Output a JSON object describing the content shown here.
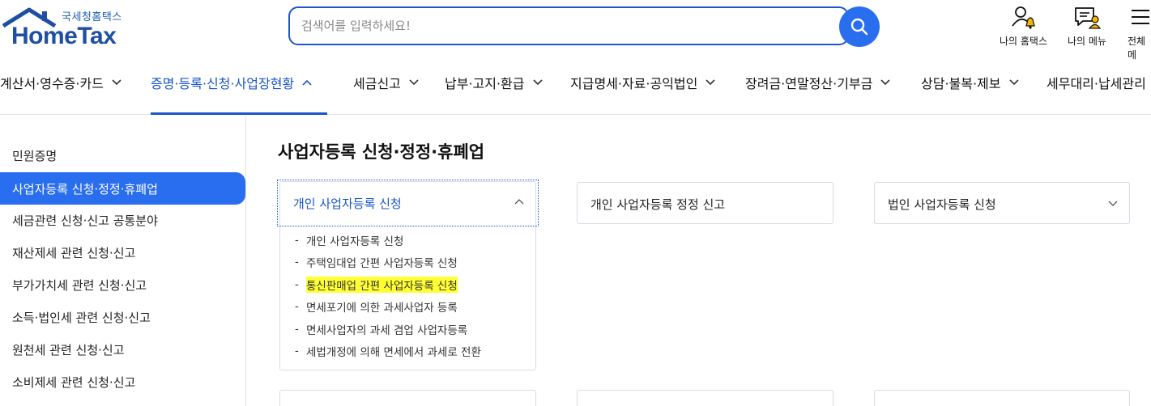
{
  "header": {
    "logo_sub": "국세청홈택스",
    "logo_main": "HomeTax",
    "search_placeholder": "검색어를 입력하세요!",
    "util": [
      {
        "label": "나의 홈택스",
        "icon": "user-bell-icon"
      },
      {
        "label": "나의 메뉴",
        "icon": "menu-user-icon"
      },
      {
        "label": "전체메",
        "icon": "hamburger-icon"
      }
    ]
  },
  "gnb": [
    {
      "label": "계산서·영수증·카드"
    },
    {
      "label": "증명·등록·신청·사업장현황",
      "active": true
    },
    {
      "label": "세금신고"
    },
    {
      "label": "납부·고지·환급"
    },
    {
      "label": "지급명세·자료·공익법인"
    },
    {
      "label": "장려금·연말정산·기부금"
    },
    {
      "label": "상담·불복·제보"
    },
    {
      "label": "세무대리·납세관리"
    }
  ],
  "sidebar": {
    "items": [
      {
        "label": "민원증명"
      },
      {
        "label": "사업자등록 신청·정정·휴폐업",
        "active": true
      },
      {
        "label": "세금관련 신청·신고 공통분야"
      },
      {
        "label": "재산제세 관련 신청·신고"
      },
      {
        "label": "부가가치세 관련 신청·신고"
      },
      {
        "label": "소득·법인세 관련 신청·신고"
      },
      {
        "label": "원천세 관련 신청·신고"
      },
      {
        "label": "소비제세 관련 신청·신고"
      }
    ]
  },
  "main": {
    "title": "사업자등록 신청·정정·휴폐업",
    "cards": [
      {
        "label": "개인 사업자등록 신청",
        "expanded": true
      },
      {
        "label": "개인 사업자등록 정정 신고"
      },
      {
        "label": "법인 사업자등록 신청"
      }
    ],
    "subitems": [
      {
        "label": "개인 사업자등록 신청"
      },
      {
        "label": "주택임대업 간편 사업자등록 신청"
      },
      {
        "label": "통신판매업 간편 사업자등록 신청",
        "highlighted": true
      },
      {
        "label": "면세포기에 의한 과세사업자 등록"
      },
      {
        "label": "면세사업자의 과세 겸업 사업자등록"
      },
      {
        "label": "세법개정에 의해 면세에서 과세로 전환"
      }
    ]
  },
  "colors": {
    "primary": "#2a6ef0",
    "accent_text": "#1a56c9",
    "highlight": "#ffff33"
  }
}
